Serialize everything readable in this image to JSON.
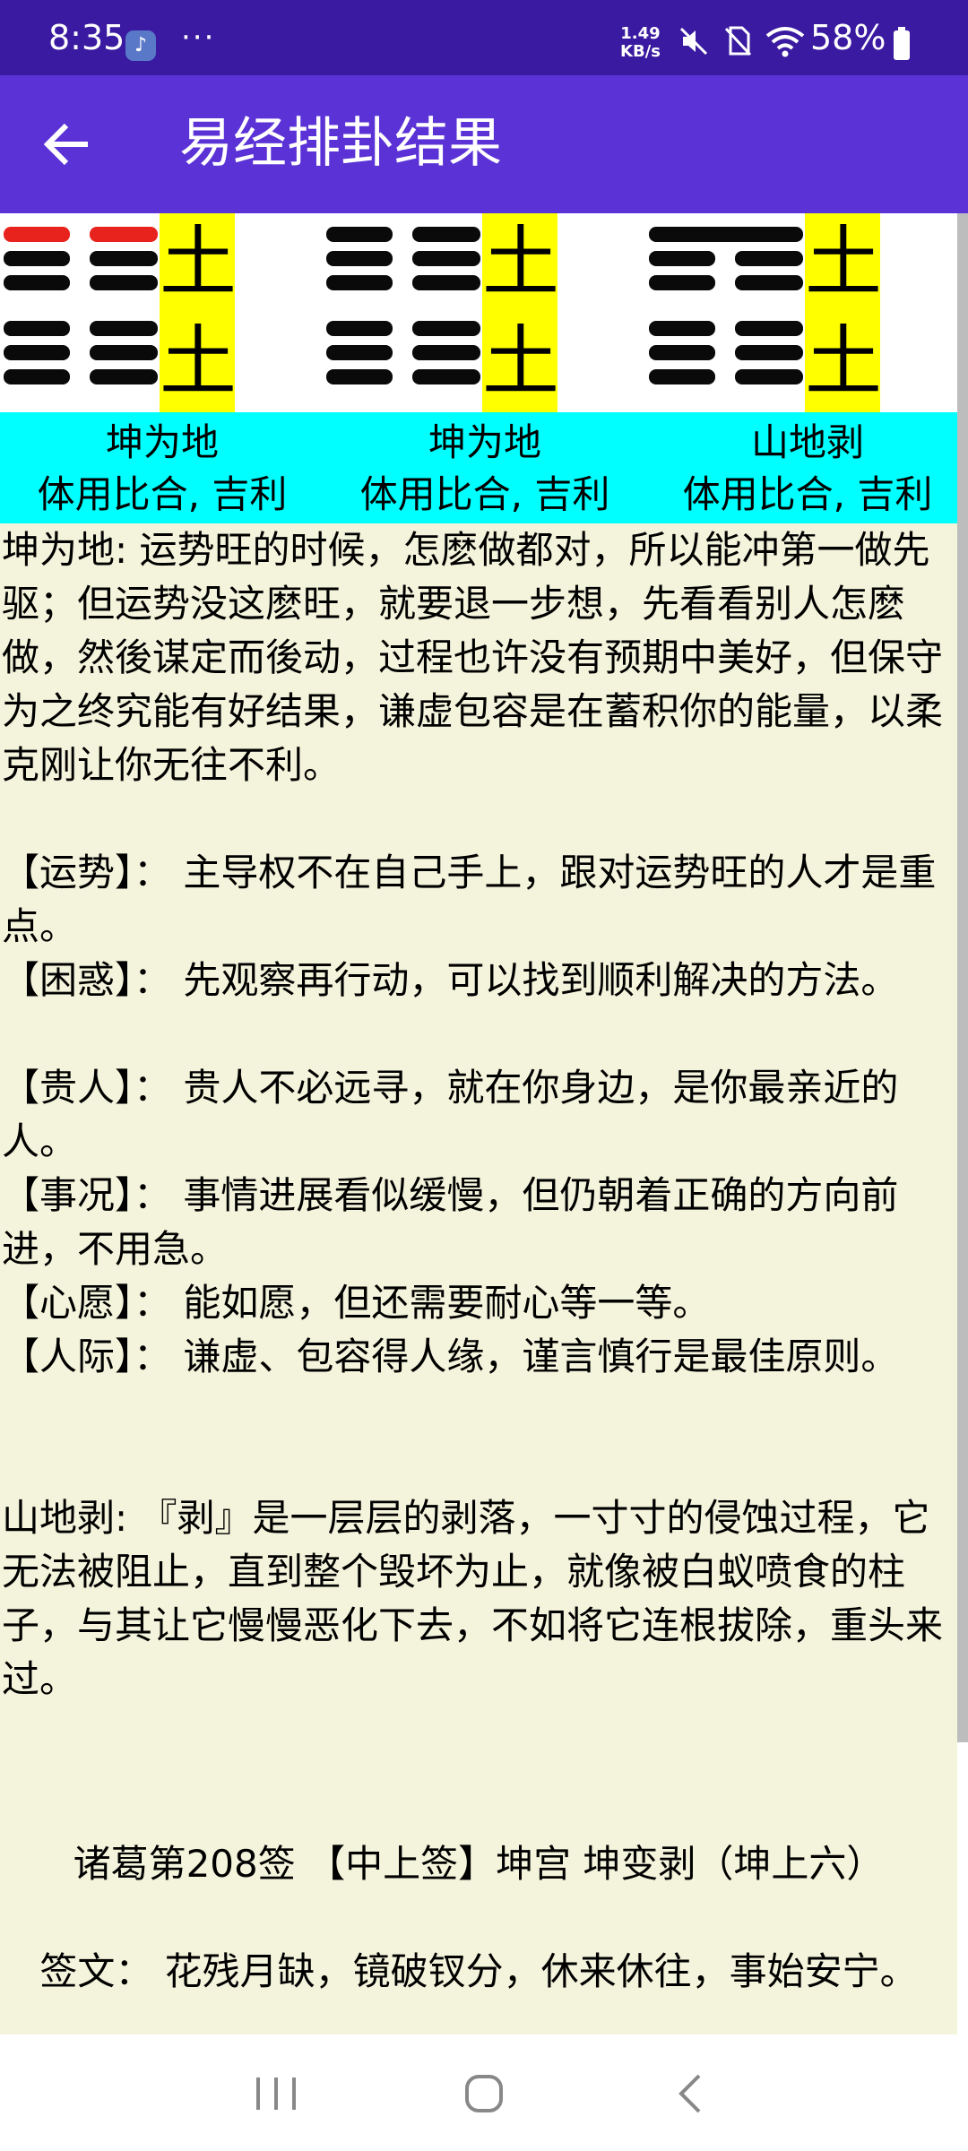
{
  "status_bar": {
    "time": "8:35",
    "more": "···",
    "net_speed_value": "1.49",
    "net_speed_unit": "KB/s",
    "battery": "58%"
  },
  "app_bar": {
    "title": "易经排卦结果"
  },
  "hexagrams": [
    {
      "name": "坤为地",
      "relation": "体用比合, 吉利",
      "upper": {
        "lines": [
          "broken",
          "broken"
        ],
        "top_line_color": "red",
        "element": "土"
      },
      "lower": {
        "lines": [
          "broken",
          "broken",
          "broken"
        ],
        "element": "土"
      }
    },
    {
      "name": "坤为地",
      "relation": "体用比合, 吉利",
      "upper": {
        "lines": [
          "broken",
          "broken"
        ],
        "element": "土"
      },
      "lower": {
        "lines": [
          "broken",
          "broken",
          "broken"
        ],
        "element": "土"
      }
    },
    {
      "name": "山地剥",
      "relation": "体用比合, 吉利",
      "upper": {
        "lines": [
          "solid",
          "broken"
        ],
        "element": "土"
      },
      "lower": {
        "lines": [
          "broken",
          "broken",
          "broken"
        ],
        "element": "土"
      }
    }
  ],
  "content": {
    "intro": "坤为地: 运势旺的时候，怎麽做都对，所以能冲第一做先驱；但运势没这麽旺，就要退一步想，先看看别人怎麽做，然後谋定而後动，过程也许没有预期中美好，但保守为之终究能有好结果，谦虚包容是在蓄积你的能量，以柔克刚让你无往不利。",
    "details": [
      {
        "label": "【运势】：",
        "text": "主导权不在自己手上，跟对运势旺的人才是重点。"
      },
      {
        "label": "【困惑】：",
        "text": "先观察再行动，可以找到顺利解决的方法。"
      },
      {
        "label": "【贵人】：",
        "text": "贵人不必远寻，就在你身边，是你最亲近的人。"
      },
      {
        "label": "【事况】：",
        "text": "事情进展看似缓慢，但仍朝着正确的方向前进，不用急。"
      },
      {
        "label": "【心愿】：",
        "text": "能如愿，但还需要耐心等一等。"
      },
      {
        "label": "【人际】：",
        "text": "谦虚、包容得人缘，谨言慎行是最佳原则。"
      }
    ],
    "changed": "山地剥: 『剥』是一层层的剥落，一寸寸的侵蚀过程，它无法被阻止，直到整个毁坏为止，就像被白蚁喷食的柱子，与其让它慢慢恶化下去，不如将它连根拔除，重头来过。",
    "sign_title": "诸葛第208签 【中上签】坤宫 坤变剥（坤上六）",
    "sign_text": "签文： 花残月缺，镜破钗分，休来休往，事始安宁。"
  },
  "colors": {
    "status_bar": "#3a1aa0",
    "app_bar": "#5b32d6",
    "element_bg": "#ffff00",
    "name_strip_bg": "#00ffff",
    "content_bg": "#f4f4dc",
    "moving_line": "#e8231e"
  },
  "icons": {
    "back": "arrow-left-icon",
    "music": "music-note-icon",
    "mute": "volume-mute-icon",
    "no_sim": "no-sim-icon",
    "wifi": "wifi-icon",
    "battery": "battery-icon",
    "nav_recents": "recents-icon",
    "nav_home": "home-icon",
    "nav_back": "back-chevron-icon"
  }
}
